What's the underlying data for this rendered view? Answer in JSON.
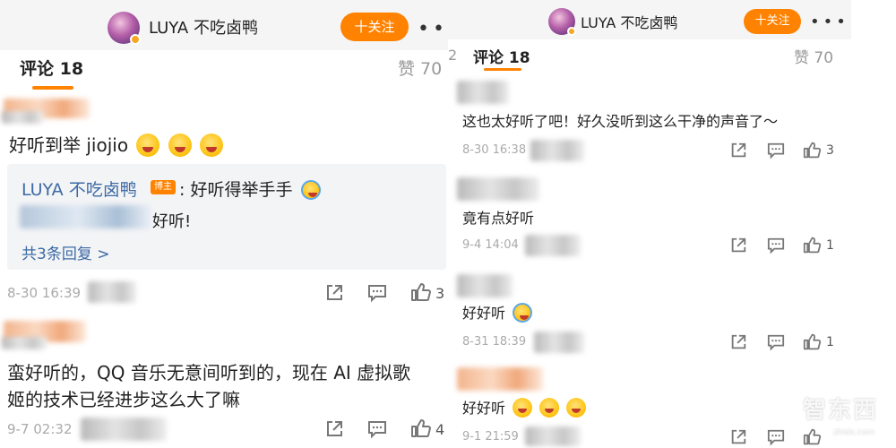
{
  "colors": {
    "accent": "#ff8200",
    "link": "#3d6aa5",
    "meta": "#aaaaaa"
  },
  "left": {
    "header": {
      "title": "LUYA 不吃卤鸭",
      "follow_label": "十关注",
      "more": "•••"
    },
    "tabs": {
      "comments": "评论 18",
      "likes": "赞 70"
    },
    "comments": [
      {
        "text": "好听到举 jiojio",
        "emojis": [
          "grin-icon",
          "grin-icon",
          "grin-icon"
        ],
        "reply": {
          "author": "LUYA 不吃卤鸭",
          "badge": "博主",
          "author_text": ": 好听得举手手",
          "second_text": "好听!",
          "more_link": "共3条回复 >"
        },
        "time": "8-30 16:39",
        "likes": "3"
      },
      {
        "text_line1": "蛮好听的，QQ 音乐无意间听到的，现在 AI 虚拟歌",
        "text_line2": "姬的技术已经进步这么大了嘛",
        "time": "9-7 02:32",
        "likes": "4"
      }
    ]
  },
  "right": {
    "header": {
      "title": "LUYA 不吃卤鸭",
      "follow_label": "十关注",
      "more": "•••"
    },
    "tabs": {
      "comments": "评论 18",
      "likes": "赞 70",
      "edge_digit": "2"
    },
    "comments": [
      {
        "text": "这也太好听了吧！好久没听到这么干净的声音了～",
        "time": "8-30 16:38",
        "likes": "3"
      },
      {
        "text": "竟有点好听",
        "time": "9-4 14:04",
        "likes": "1"
      },
      {
        "text": "好好听",
        "emojis": [
          "laugh-cry-icon"
        ],
        "time": "8-31 18:39",
        "likes": "1"
      },
      {
        "text": "好好听",
        "emojis": [
          "grin-icon",
          "grin-icon",
          "grin-icon"
        ],
        "time": "9-1 21:59",
        "likes": ""
      }
    ]
  },
  "watermark": {
    "main": "智东西",
    "sub": "zhidx.com"
  }
}
